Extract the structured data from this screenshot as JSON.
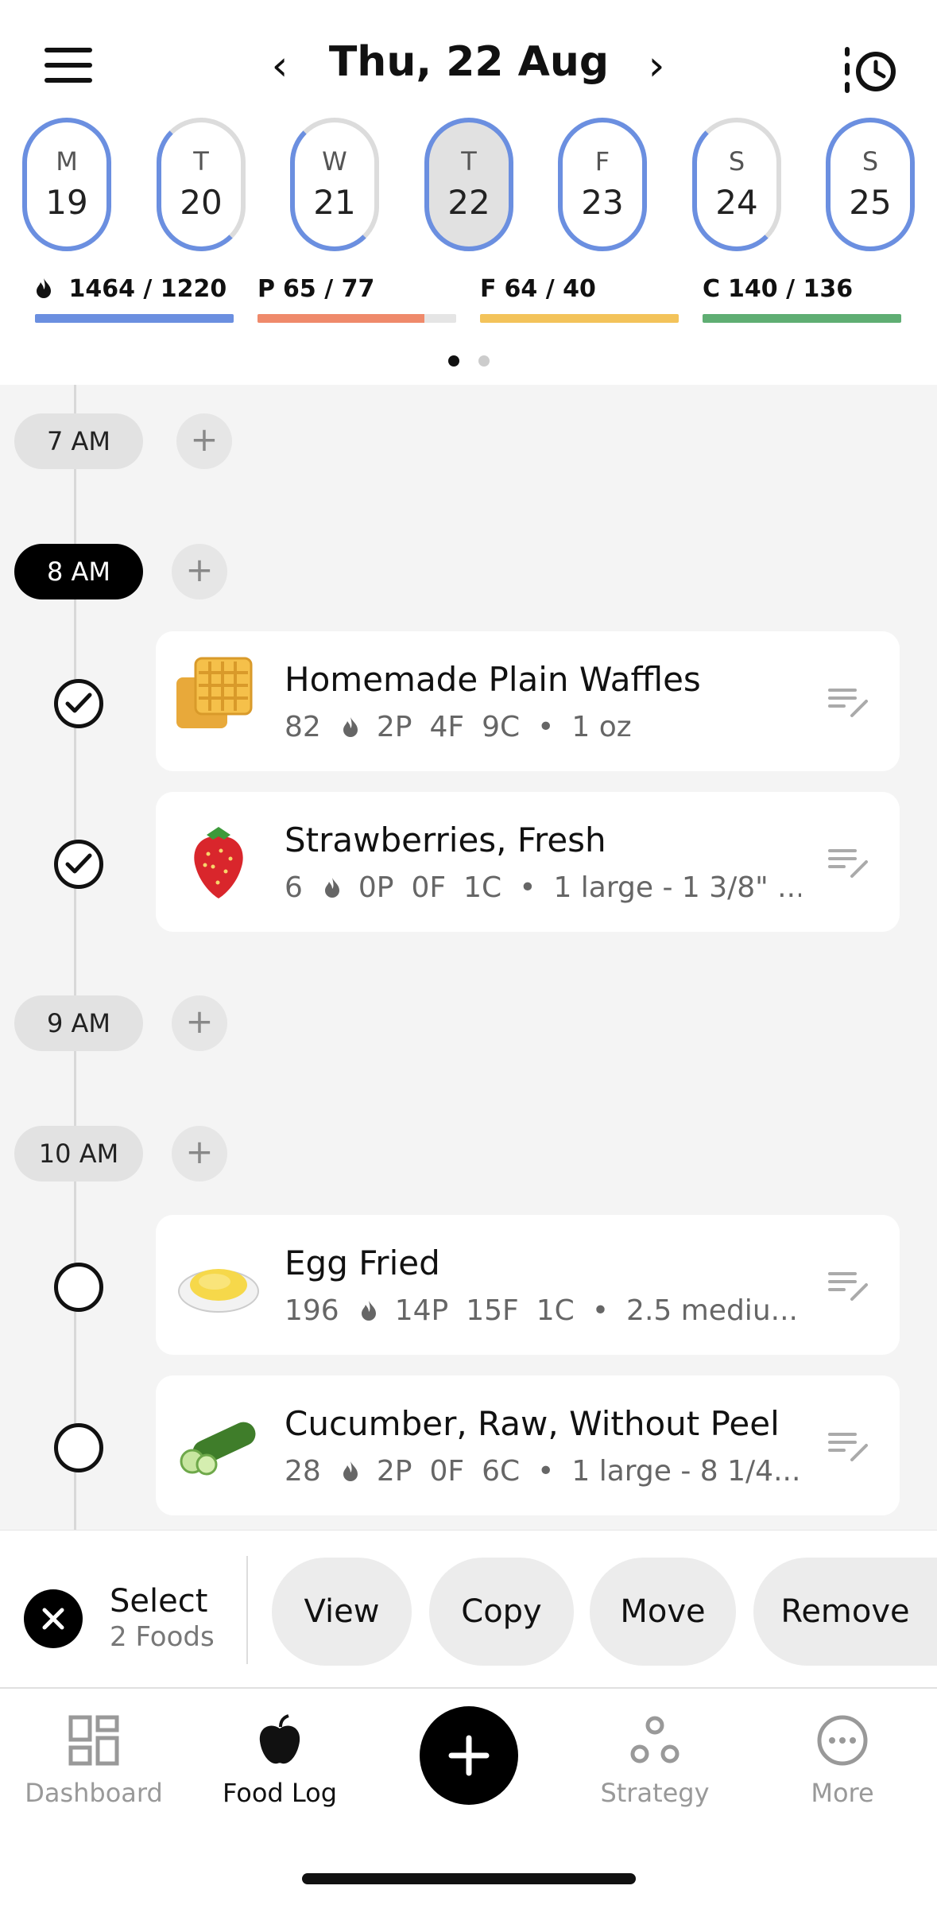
{
  "header": {
    "date_title": "Thu, 22 Aug",
    "prev_label": "‹",
    "next_label": "›"
  },
  "week": [
    {
      "letter": "M",
      "num": "19"
    },
    {
      "letter": "T",
      "num": "20"
    },
    {
      "letter": "W",
      "num": "21"
    },
    {
      "letter": "T",
      "num": "22"
    },
    {
      "letter": "F",
      "num": "23"
    },
    {
      "letter": "S",
      "num": "24"
    },
    {
      "letter": "S",
      "num": "25"
    }
  ],
  "macros": {
    "calories": {
      "label": "1464 / 1220",
      "progress": 1.0,
      "color": "#6b8fe0"
    },
    "protein": {
      "symbol": "P",
      "label": "65 / 77",
      "progress": 0.84,
      "color": "#ef8a6b"
    },
    "fat": {
      "symbol": "F",
      "label": "64 / 40",
      "progress": 1.0,
      "color": "#f3c35a"
    },
    "carbs": {
      "symbol": "C",
      "label": "140 / 136",
      "progress": 1.0,
      "color": "#5fae73"
    }
  },
  "timeline": {
    "times": [
      "7 AM",
      "8 AM",
      "9 AM",
      "10 AM"
    ],
    "add_label": "+",
    "foods": [
      {
        "name": "Homemade Plain Waffles",
        "cal": "82",
        "p": "2P",
        "f": "4F",
        "c": "9C",
        "serving": "1 oz",
        "checked": true
      },
      {
        "name": "Strawberries, Fresh",
        "cal": "6",
        "p": "0P",
        "f": "0F",
        "c": "1C",
        "serving": "1 large - 1 3/8\" ...",
        "checked": true
      },
      {
        "name": "Egg Fried",
        "cal": "196",
        "p": "14P",
        "f": "15F",
        "c": "1C",
        "serving": "2.5 mediu...",
        "checked": false
      },
      {
        "name": "Cucumber, Raw, Without Peel",
        "cal": "28",
        "p": "2P",
        "f": "0F",
        "c": "6C",
        "serving": "1 large - 8 1/4...",
        "checked": false
      }
    ]
  },
  "selection": {
    "title": "Select",
    "subtitle": "2 Foods",
    "actions": [
      "View",
      "Copy",
      "Move",
      "Remove"
    ]
  },
  "bottom_nav": {
    "dashboard": "Dashboard",
    "food_log": "Food Log",
    "strategy": "Strategy",
    "more": "More"
  },
  "colors": {
    "accent_blue": "#6b8fe0",
    "timeline_bg": "#f4f4f4"
  }
}
